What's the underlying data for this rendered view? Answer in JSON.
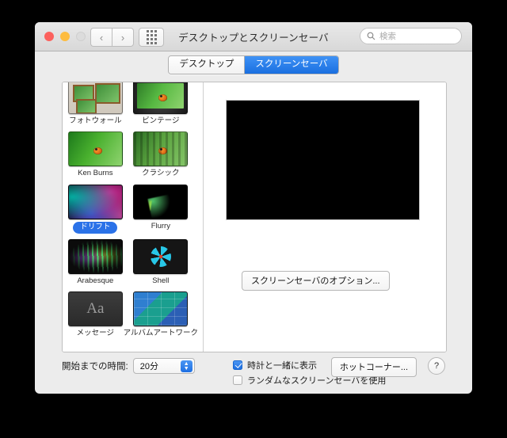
{
  "window": {
    "title": "デスクトップとスクリーンセーバ",
    "traffic_lights": [
      "close-red",
      "minimize-yellow",
      "zoom-disabled"
    ],
    "nav": {
      "back": "‹",
      "forward": "›"
    },
    "show_all_icon": "grid-icon",
    "search": {
      "placeholder": "検索",
      "value": "",
      "icon": "search-icon"
    }
  },
  "tabs": [
    {
      "label": "デスクトップ",
      "active": false
    },
    {
      "label": "スクリーンセーバ",
      "active": true
    }
  ],
  "savers": [
    {
      "label": "フォトウォール",
      "art": "t-photowall",
      "selected": false
    },
    {
      "label": "ビンテージ",
      "art": "t-vintage",
      "selected": false
    },
    {
      "label": "Ken Burns",
      "art": "t-kenburns",
      "selected": false
    },
    {
      "label": "クラシック",
      "art": "t-classic",
      "selected": false
    },
    {
      "label": "ドリフト",
      "art": "t-drift",
      "selected": true
    },
    {
      "label": "Flurry",
      "art": "t-flurry",
      "selected": false
    },
    {
      "label": "Arabesque",
      "art": "t-arabesque",
      "selected": false
    },
    {
      "label": "Shell",
      "art": "t-shell",
      "selected": false
    },
    {
      "label": "メッセージ",
      "art": "t-message",
      "selected": false
    },
    {
      "label": "アルバムアートワーク",
      "art": "t-album",
      "selected": false
    }
  ],
  "preview": {
    "background_color": "#000000"
  },
  "options_button": "スクリーンセーバのオプション...",
  "bottom": {
    "start_after_label": "開始までの時間:",
    "start_after_value": "20分",
    "show_with_clock": {
      "label": "時計と一緒に表示",
      "checked": true
    },
    "use_random": {
      "label": "ランダムなスクリーンセーバを使用",
      "checked": false
    },
    "hot_corners_button": "ホットコーナー...",
    "help_button": "?"
  },
  "colors": {
    "accent": "#1d6fe2",
    "window_bg": "#ececec",
    "panel_bg": "#ffffff"
  }
}
